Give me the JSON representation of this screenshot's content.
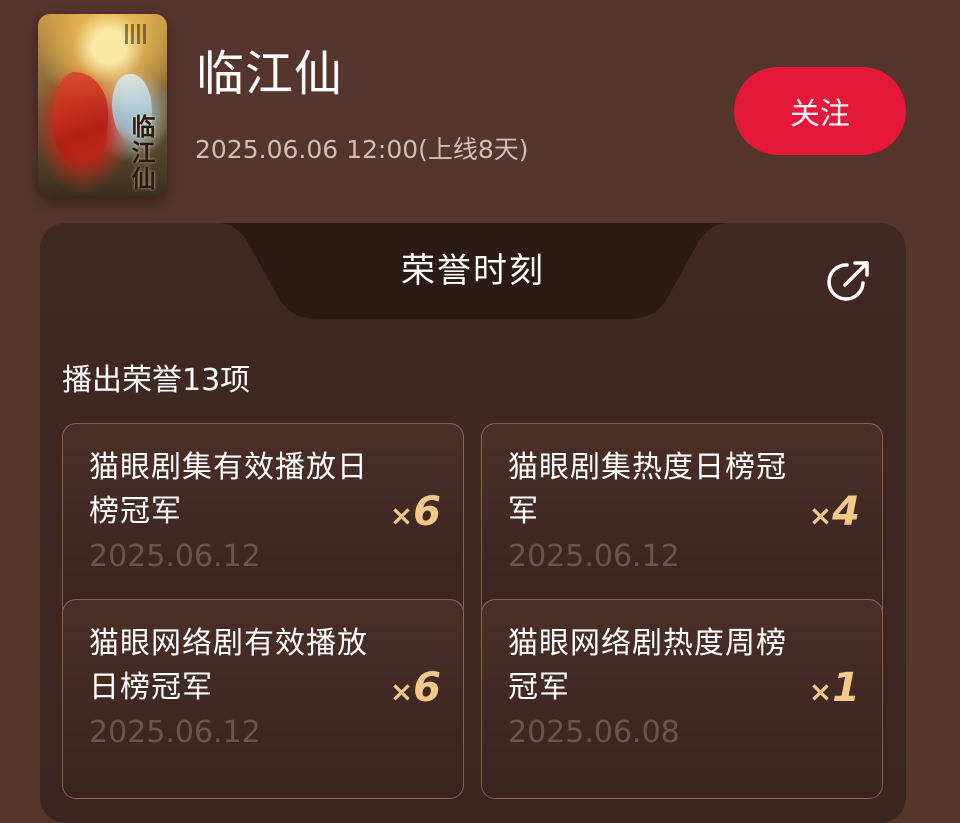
{
  "show": {
    "title": "临江仙",
    "release_info": "2025.06.06 12:00(上线8天)",
    "poster_title": "临江仙",
    "follow_label": "关注"
  },
  "honor": {
    "tab_title": "荣誉时刻",
    "section_heading": "播出荣誉13项",
    "awards": [
      {
        "name": "猫眼剧集有效播放日榜冠军",
        "count_prefix": "×",
        "count": "6",
        "date": "2025.06.12"
      },
      {
        "name": "猫眼剧集热度日榜冠军",
        "count_prefix": "×",
        "count": "4",
        "date": "2025.06.12"
      },
      {
        "name": "猫眼网络剧有效播放日榜冠军",
        "count_prefix": "×",
        "count": "6",
        "date": "2025.06.12"
      },
      {
        "name": "猫眼网络剧热度周榜冠军",
        "count_prefix": "×",
        "count": "1",
        "date": "2025.06.08"
      }
    ]
  },
  "colors": {
    "background": "#55352c",
    "accent": "#e6183a",
    "count_gold": "#f3c889"
  },
  "icons": {
    "share": "share-arrow-icon"
  }
}
